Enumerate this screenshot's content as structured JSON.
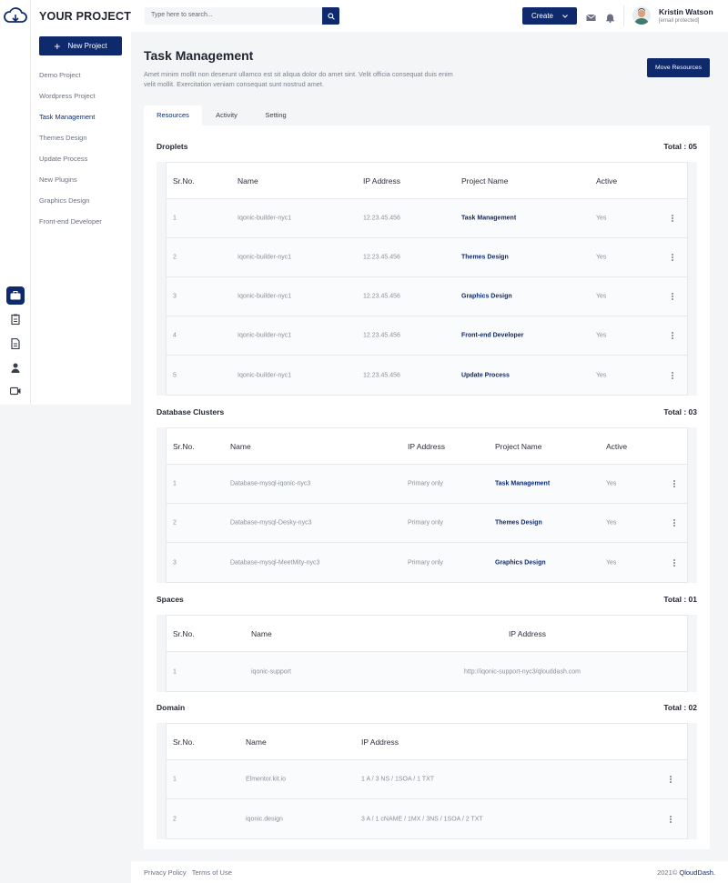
{
  "sidebar": {
    "title": "YOUR PROJECTS",
    "new_project_label": "New Project",
    "projects": [
      {
        "label": "Demo Project"
      },
      {
        "label": "Wordpress Project"
      },
      {
        "label": "Task Management"
      },
      {
        "label": "Themes Design"
      },
      {
        "label": "Update Process"
      },
      {
        "label": "New Plugins"
      },
      {
        "label": "Graphics Design"
      },
      {
        "label": "Front-end Developer"
      }
    ],
    "active_project_index": 2
  },
  "rail": {
    "icons": [
      "briefcase-icon",
      "clipboard-icon",
      "document-icon",
      "user-icon",
      "video-icon"
    ],
    "active_index": 0
  },
  "topbar": {
    "search_placeholder": "Type here to search...",
    "create_label": "Create",
    "user_name": "Kristin Watson",
    "user_email": "[email protected]"
  },
  "page": {
    "title": "Task Management",
    "description": "Amet minim mollit non deserunt ullamco est sit aliqua dolor do amet sint. Velit officia consequat duis enim velit mollit. Exercitation veniam consequat sunt nostrud amet.",
    "move_label": "Move Resources",
    "tabs": [
      {
        "label": "Resources"
      },
      {
        "label": "Activity"
      },
      {
        "label": "Setting"
      }
    ],
    "active_tab": 0
  },
  "droplets": {
    "title": "Droplets",
    "total": "Total : 05",
    "headers": [
      "Sr.No.",
      "Name",
      "IP Address",
      "Project Name",
      "Active"
    ],
    "rows": [
      {
        "sr": "1",
        "name": "Iqonic-builder-nyc1",
        "ip": "12.23.45.456",
        "project": "Task Management",
        "active": "Yes"
      },
      {
        "sr": "2",
        "name": "Iqonic-builder-nyc1",
        "ip": "12.23.45.456",
        "project": "Themes Design",
        "active": "Yes"
      },
      {
        "sr": "3",
        "name": "Iqonic-builder-nyc1",
        "ip": "12.23.45.456",
        "project": "Graphics Design",
        "active": "Yes"
      },
      {
        "sr": "4",
        "name": "Iqonic-builder-nyc1",
        "ip": "12.23.45.456",
        "project": "Front-end Developer",
        "active": "Yes"
      },
      {
        "sr": "5",
        "name": "Iqonic-builder-nyc1",
        "ip": "12.23.45.456",
        "project": "Update Process",
        "active": "Yes"
      }
    ]
  },
  "clusters": {
    "title": "Database Clusters",
    "total": "Total : 03",
    "headers": [
      "Sr.No.",
      "Name",
      "IP Address",
      "Project Name",
      "Active"
    ],
    "rows": [
      {
        "sr": "1",
        "name": "Database-mysql-iqonic-nyc3",
        "ip": "Primary only",
        "project": "Task Management",
        "active": "Yes"
      },
      {
        "sr": "2",
        "name": "Database-mysql-Desky-nyc3",
        "ip": "Primary only",
        "project": "Themes Design",
        "active": "Yes"
      },
      {
        "sr": "3",
        "name": "Database-mysql-MeetMity-nyc3",
        "ip": "Primary only",
        "project": "Graphics Design",
        "active": "Yes"
      }
    ]
  },
  "spaces": {
    "title": "Spaces",
    "total": "Total : 01",
    "headers": [
      "Sr.No.",
      "Name",
      "IP Address"
    ],
    "rows": [
      {
        "sr": "1",
        "name": "iqonic-support",
        "ip": "http://iqonic-support-nyc3/qlouddash.com"
      }
    ]
  },
  "domain": {
    "title": "Domain",
    "total": "Total : 02",
    "headers": [
      "Sr.No.",
      "Name",
      "IP Address"
    ],
    "rows": [
      {
        "sr": "1",
        "name": "Elmentor.kit.io",
        "ip": "1 A / 3 NS / 1SOA / 1 TXT"
      },
      {
        "sr": "2",
        "name": "iqonic.design",
        "ip": "3 A / 1 cNAME / 1MX / 3NS / 1SOA / 2 TXT"
      }
    ]
  },
  "footer": {
    "privacy": "Privacy Policy",
    "terms": "Terms of Use",
    "copyright": "2021©",
    "brand": "QloudDash."
  },
  "colors": {
    "accent": "#0e2a6d",
    "background": "#f4f5f7"
  }
}
